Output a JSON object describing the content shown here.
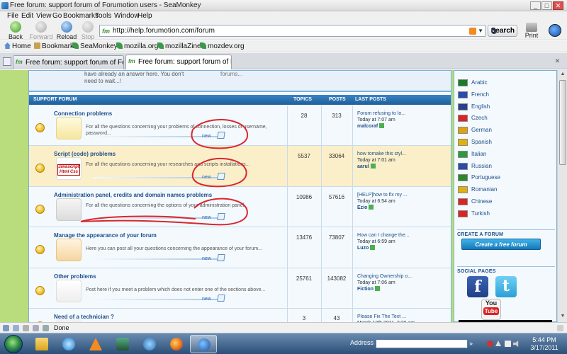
{
  "window": {
    "title": "Free forum: support forum of Forumotion users - SeaMonkey",
    "buttons": [
      "_",
      "□",
      "✕"
    ]
  },
  "menu": [
    "File",
    "Edit",
    "View",
    "Go",
    "Bookmarks",
    "Tools",
    "Window",
    "Help"
  ],
  "nav": {
    "back": "Back",
    "forward": "Forward",
    "reload": "Reload",
    "stop": "Stop",
    "url": "http://help.forumotion.com/forum",
    "search": "Search",
    "print": "Print",
    "favicon": "fm"
  },
  "bookmarks": [
    "Home",
    "Bookmarks",
    "SeaMonkey",
    "mozilla.org",
    "mozillaZine",
    "mozdev.org"
  ],
  "tabs": [
    {
      "label": "Free forum: support forum of Forumotion..."
    },
    {
      "label": "Free forum: support forum of Forumoti..."
    }
  ],
  "top_fragment": {
    "text": "have already an answer here. You don't need to wait...!",
    "right": "forums..."
  },
  "forum_header": {
    "section": "SUPPORT FORUM",
    "topics": "TOPICS",
    "posts": "POSTS",
    "last_posts": "LAST POSTS"
  },
  "forums": [
    {
      "name": "Connection problems",
      "desc": "For all the questions concerning your problems of connection, losses of username, password...",
      "new": "new",
      "topics": "28",
      "posts": "313",
      "last_title": "Forum refusing to lo...",
      "last_time": "Today at 7:07 am",
      "last_user": "malcoraf",
      "art_text": ""
    },
    {
      "name": "Script (code) problems",
      "desc": "For all the questions concerning your researches and scripts installations...",
      "new": "new",
      "topics": "5537",
      "posts": "33064",
      "last_title": "how tomake this styl...",
      "last_time": "Today at 7:01 am",
      "last_user": "aarul",
      "art_text": "Javascript Html Css"
    },
    {
      "name": "Administration panel, credits and domain names problems",
      "desc": "For all the questions concerning the options of your administration panel.",
      "new": "new",
      "topics": "10986",
      "posts": "57616",
      "last_title": "[HELP]how to fix my ...",
      "last_time": "Today at 6:54 am",
      "last_user": "Ezio",
      "art_text": ""
    },
    {
      "name": "Manage the appearance of your forum",
      "desc": "Here you can post all your questions concerning the appearance of your forum...",
      "new": "new",
      "topics": "13476",
      "posts": "73807",
      "last_title": "How can I change the...",
      "last_time": "Today at 6:59 am",
      "last_user": "Luzo",
      "art_text": ""
    },
    {
      "name": "Other problems",
      "desc": "Post here if you meet a problem which does not enter one of the sections above...",
      "new": "new",
      "topics": "25761",
      "posts": "143082",
      "last_title": "Changing Ownership o...",
      "last_time": "Today at 7:06 am",
      "last_user": "Fiction",
      "art_text": ""
    },
    {
      "name": "Need of a technician ?",
      "desc": "",
      "new": "",
      "topics": "3",
      "posts": "43",
      "last_title": "Please Fix The Text ...",
      "last_time": "March 12th 2011, 3:26 am",
      "last_user": "",
      "art_text": ""
    }
  ],
  "languages": [
    {
      "name": "Arabic",
      "flag": "#1a7a2a"
    },
    {
      "name": "French",
      "flag": "#2a4ab0"
    },
    {
      "name": "English",
      "flag": "#2b3f8f"
    },
    {
      "name": "Czech",
      "flag": "#d22"
    },
    {
      "name": "German",
      "flag": "#e0a010"
    },
    {
      "name": "Spanish",
      "flag": "#e0b010"
    },
    {
      "name": "Italian",
      "flag": "#2a9a3a"
    },
    {
      "name": "Russian",
      "flag": "#2a4ab0"
    },
    {
      "name": "Portuguese",
      "flag": "#2a8a2a"
    },
    {
      "name": "Romanian",
      "flag": "#e0b010"
    },
    {
      "name": "Chinese",
      "flag": "#d22"
    },
    {
      "name": "Turkish",
      "flag": "#d22"
    }
  ],
  "side": {
    "create_head": "CREATE A FORUM",
    "create_button": "Create a free forum",
    "social_head": "SOCIAL PAGES",
    "social": {
      "facebook": "f",
      "twitter": "t",
      "youtube_top": "You",
      "youtube_bottom": "Tube"
    }
  },
  "status": {
    "text": "Done"
  },
  "taskbar": {
    "address_label": "Address",
    "time": "5:44 PM",
    "date": "3/17/2011"
  },
  "colors": {
    "page_bg": "#b9dd7d",
    "forum_header": "#2a70ad",
    "link": "#1d4f8a",
    "annotation": "#d9262e"
  }
}
